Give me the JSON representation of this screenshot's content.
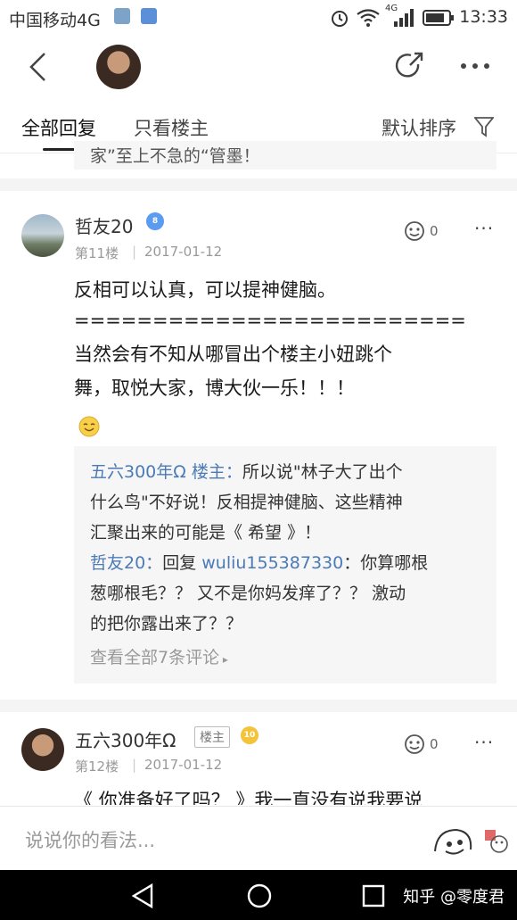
{
  "status_bar": {
    "carrier": "中国移动4G",
    "network": "4G",
    "time": "13:33"
  },
  "top_nav": {
    "back_icon": "chevron-left-icon",
    "share_icon": "share-icon",
    "more_icon": "more-dots-icon"
  },
  "tabs": {
    "all": "全部回复",
    "owner_only": "只看楼主",
    "sort": "默认排序",
    "filter_icon": "filter-icon"
  },
  "previous_reply_fragment": "家”至上不急的“管墨！",
  "comments": [
    {
      "name": "哲友20",
      "badge": "8",
      "floor": "第11楼",
      "date": "2017-01-12",
      "likes": "0",
      "body_lines": [
        "反相可以认真，可以提神健脑。",
        "=========================",
        "当然会有不知从哪冒出个楼主小妞跳个",
        "舞，取悦大家，博大伙一乐！！！"
      ],
      "emoji": "smile-emoji",
      "replies": {
        "lines": [
          {
            "user": "五六300年Ω 楼主：",
            "text": "所以说\"林子大了出个"
          },
          {
            "user": "",
            "text": "什么鸟\"不好说！反相提神健脑、这些精神"
          },
          {
            "user": "",
            "text": "汇聚出来的可能是《 希望 》！"
          },
          {
            "user": "哲友20：",
            "text": "回复 ",
            "mention": "wuliu155387330",
            "tail": "：你算哪根"
          },
          {
            "user": "",
            "text": "葱哪根毛？？ 又不是你妈发痒了？？ 激动"
          },
          {
            "user": "",
            "text": "的把你露出来了？？"
          }
        ],
        "view_all": "查看全部7条评论"
      }
    },
    {
      "name": "五六300年Ω",
      "tag": "楼主",
      "badge": "10",
      "floor": "第12楼",
      "date": "2017-01-12",
      "likes": "0",
      "body_partial": "《 你准备好了吗？ 》我一直没有说我要说"
    }
  ],
  "input_bar": {
    "placeholder": "说说你的看法...",
    "emoji_icon": "emoji-face-icon"
  },
  "android_nav": {
    "back": "back-triangle-icon",
    "home": "home-circle-icon",
    "recents": "recents-square-icon",
    "watermark": "知乎 @零度君"
  },
  "colors": {
    "accent_blue": "#4b7bb7",
    "badge_blue": "#5b9bf0",
    "badge_gold": "#f3c33a"
  }
}
